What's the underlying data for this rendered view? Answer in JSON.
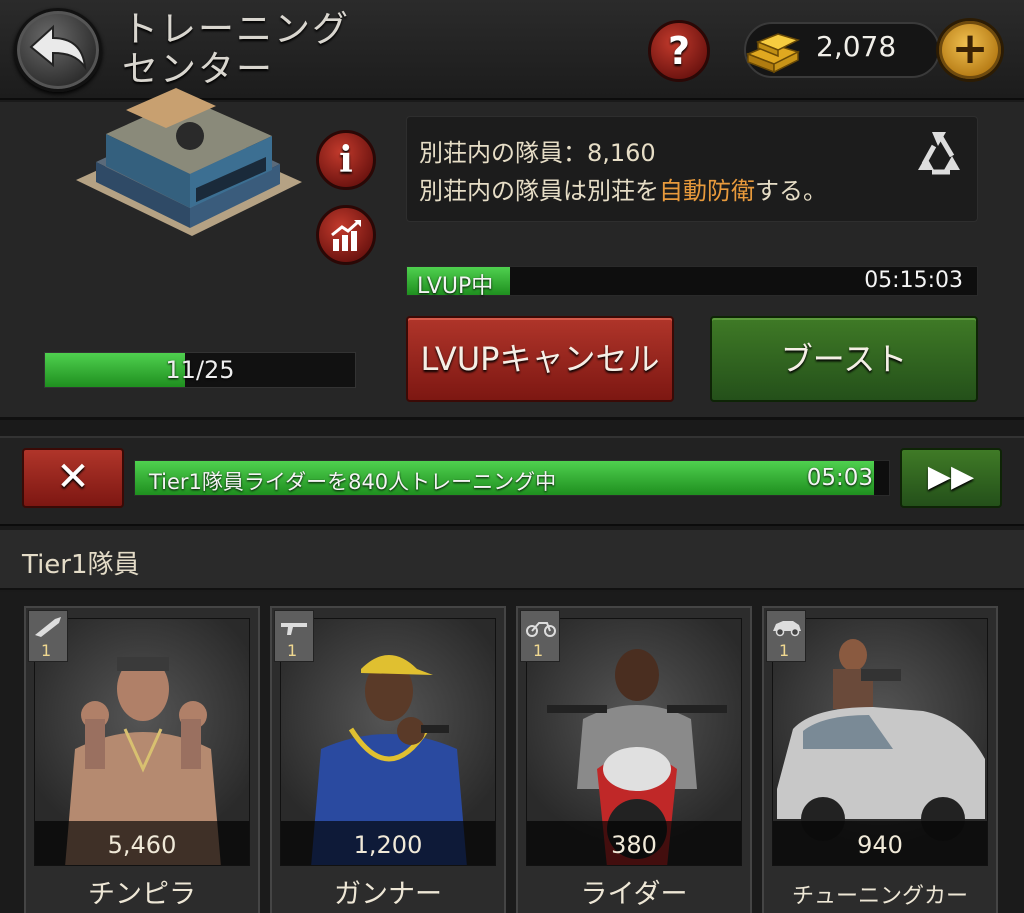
{
  "header": {
    "title_line1": "トレーニング",
    "title_line2": "センター",
    "help_label": "?",
    "gold_amount": "2,078",
    "plus_label": "+"
  },
  "building": {
    "info_label": "i",
    "level_text": "11/25",
    "level_progress": 0.45
  },
  "info": {
    "line1": "別荘内の隊員：8,160",
    "line2_pre": "別荘内の隊員は別荘を",
    "line2_highlight": "自動防衛",
    "line2_post": "する。"
  },
  "upgrade": {
    "label": "LVUP中",
    "time": "05:15:03",
    "progress": 0.18,
    "cancel_label": "LVUPキャンセル",
    "boost_label": "ブースト"
  },
  "training": {
    "stop_label": "✕",
    "label": "Tier1隊員ライダーを840人トレーニング中",
    "time": "05:03",
    "progress": 0.98,
    "ff_label": "▶▶"
  },
  "tier": {
    "title": "Tier1隊員",
    "units": [
      {
        "name": "チンピラ",
        "count": "5,460",
        "tier": "1"
      },
      {
        "name": "ガンナー",
        "count": "1,200",
        "tier": "1"
      },
      {
        "name": "ライダー",
        "count": "380",
        "tier": "1"
      },
      {
        "name": "チューニングカー",
        "count": "940",
        "tier": "1"
      }
    ]
  },
  "colors": {
    "accent_orange": "#e89a3c",
    "progress_green": "#2fae2f",
    "button_red": "#9a2418",
    "button_green": "#336a22"
  }
}
